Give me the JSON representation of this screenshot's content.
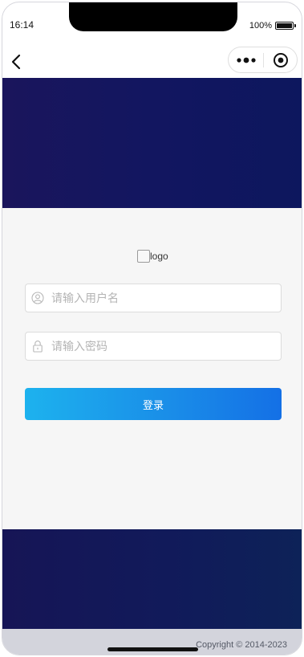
{
  "status_bar": {
    "time": "16:14",
    "battery_text": "100%",
    "battery_level": 1.0
  },
  "nav": {
    "back_icon": "chevron-left-icon",
    "more_icon": "more-dots-icon",
    "close_icon": "target-circle-icon"
  },
  "banner": {
    "top_color": "#121660",
    "bottom_color": "#111a5a"
  },
  "login": {
    "logo_alt": "logo",
    "username_placeholder": "请输入用户名",
    "username_value": "",
    "password_placeholder": "请输入密码",
    "password_value": "",
    "submit_label": "登录",
    "button_color_start": "#1db2ee",
    "button_color_end": "#1470e6"
  },
  "footer": {
    "copyright": "Copyright © 2014-2023"
  }
}
